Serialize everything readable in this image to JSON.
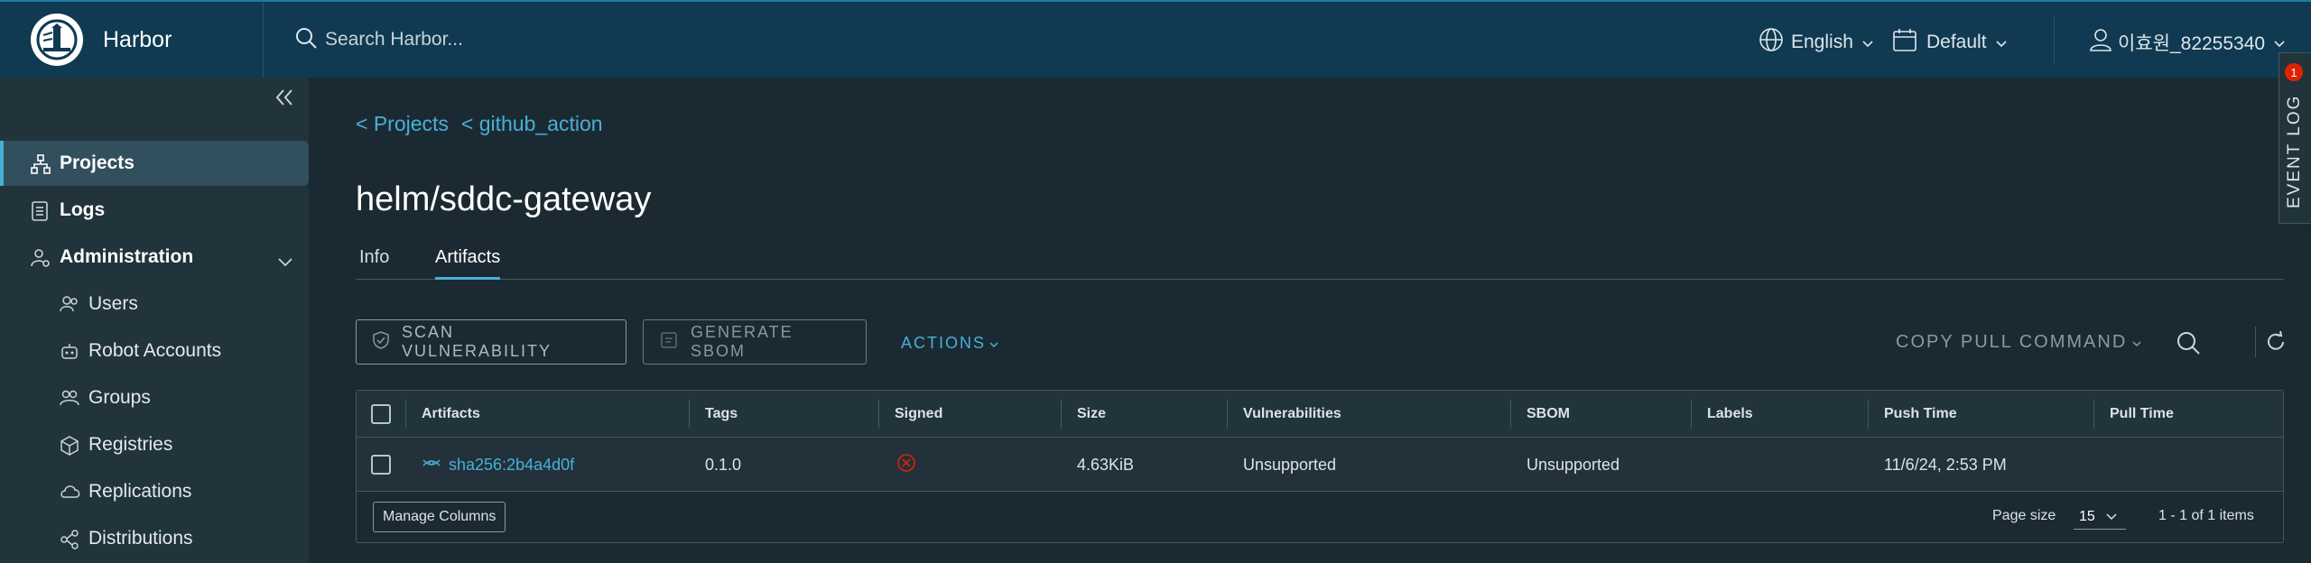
{
  "header": {
    "brand": "Harbor",
    "search_placeholder": "Search Harbor...",
    "language": "English",
    "theme": "Default",
    "user": "이효원_82255340"
  },
  "sidebar": {
    "items": [
      {
        "label": "Projects",
        "icon": "projects-icon"
      },
      {
        "label": "Logs",
        "icon": "logs-icon"
      },
      {
        "label": "Administration",
        "icon": "administration-icon"
      },
      {
        "label": "Users",
        "icon": "users-icon"
      },
      {
        "label": "Robot Accounts",
        "icon": "robot-icon"
      },
      {
        "label": "Groups",
        "icon": "groups-icon"
      },
      {
        "label": "Registries",
        "icon": "registries-icon"
      },
      {
        "label": "Replications",
        "icon": "replications-icon"
      },
      {
        "label": "Distributions",
        "icon": "distributions-icon"
      }
    ]
  },
  "breadcrumb": {
    "projects": "< Projects",
    "project": "< github_action"
  },
  "page_title": "helm/sddc-gateway",
  "tabs": [
    {
      "label": "Info"
    },
    {
      "label": "Artifacts"
    }
  ],
  "toolbar": {
    "scan": "SCAN VULNERABILITY",
    "sbom": "GENERATE SBOM",
    "actions": "ACTIONS",
    "copy_pull": "COPY PULL COMMAND"
  },
  "table": {
    "headers": [
      "Artifacts",
      "Tags",
      "Signed",
      "Size",
      "Vulnerabilities",
      "SBOM",
      "Labels",
      "Push Time",
      "Pull Time"
    ],
    "rows": [
      {
        "artifact": "sha256:2b4a4d0f",
        "tags": "0.1.0",
        "size": "4.63KiB",
        "vulnerabilities": "Unsupported",
        "sbom": "Unsupported",
        "labels": "",
        "push_time": "11/6/24, 2:53 PM",
        "pull_time": ""
      }
    ],
    "manage_columns": "Manage Columns",
    "page_size_label": "Page size",
    "page_size": "15",
    "range": "1 - 1 of 1 items"
  },
  "event_log": {
    "label": "EVENT LOG",
    "count": "1"
  },
  "colors": {
    "accent": "#49afd9",
    "header": "#0f3a52",
    "error": "#e12200"
  }
}
